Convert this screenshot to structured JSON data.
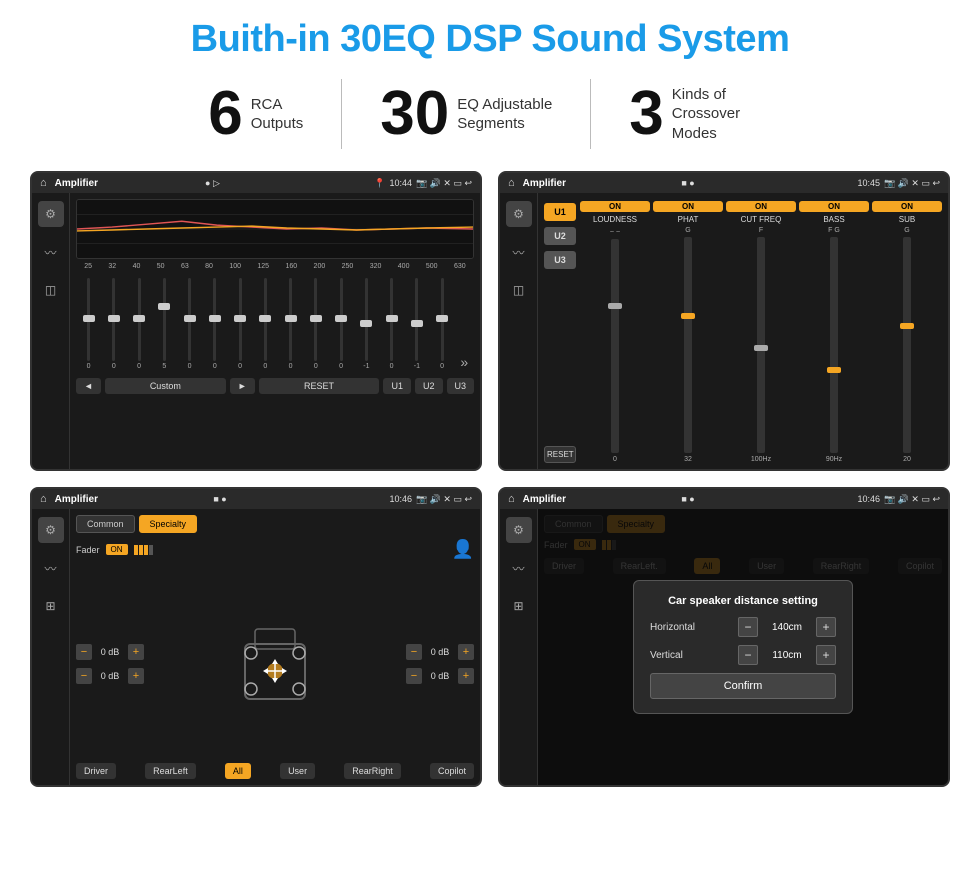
{
  "header": {
    "title": "Buith-in 30EQ DSP Sound System"
  },
  "stats": [
    {
      "number": "6",
      "label": "RCA\nOutputs"
    },
    {
      "number": "30",
      "label": "EQ Adjustable\nSegments"
    },
    {
      "number": "3",
      "label": "Kinds of\nCrossover Modes"
    }
  ],
  "screens": [
    {
      "id": "eq-screen",
      "status_bar": {
        "app": "Amplifier",
        "time": "10:44"
      },
      "eq_bands": [
        "25",
        "32",
        "40",
        "50",
        "63",
        "80",
        "100",
        "125",
        "160",
        "200",
        "250",
        "320",
        "400",
        "500",
        "630"
      ],
      "eq_values": [
        "0",
        "0",
        "0",
        "5",
        "0",
        "0",
        "0",
        "0",
        "0",
        "0",
        "0",
        "-1",
        "0",
        "-1"
      ],
      "controls": [
        "◄",
        "Custom",
        "►",
        "RESET",
        "U1",
        "U2",
        "U3"
      ]
    },
    {
      "id": "crossover-screen",
      "status_bar": {
        "app": "Amplifier",
        "time": "10:45"
      },
      "presets": [
        "U1",
        "U2",
        "U3"
      ],
      "params": [
        {
          "name": "LOUDNESS",
          "on": true
        },
        {
          "name": "PHAT",
          "on": true
        },
        {
          "name": "CUT FREQ",
          "on": true
        },
        {
          "name": "BASS",
          "on": true
        },
        {
          "name": "SUB",
          "on": true
        }
      ]
    },
    {
      "id": "speaker-screen",
      "status_bar": {
        "app": "Amplifier",
        "time": "10:46"
      },
      "tabs": [
        "Common",
        "Specialty"
      ],
      "fader": {
        "label": "Fader",
        "on": true
      },
      "vol_groups": [
        {
          "top": "0 dB",
          "bottom": "0 dB"
        },
        {
          "top": "0 dB",
          "bottom": "0 dB"
        }
      ],
      "bottom_labels": [
        "Driver",
        "RearLeft",
        "All",
        "User",
        "RearRight",
        "Copilot"
      ]
    },
    {
      "id": "speaker-dialog-screen",
      "status_bar": {
        "app": "Amplifier",
        "time": "10:46"
      },
      "tabs": [
        "Common",
        "Specialty"
      ],
      "dialog": {
        "title": "Car speaker distance setting",
        "fields": [
          {
            "label": "Horizontal",
            "value": "140cm"
          },
          {
            "label": "Vertical",
            "value": "110cm"
          }
        ],
        "confirm_label": "Confirm"
      },
      "bottom_labels": [
        "Driver",
        "RearLeft",
        "All",
        "User",
        "RearRight",
        "Copilot"
      ]
    }
  ],
  "colors": {
    "accent": "#1a9be8",
    "gold": "#f5a623",
    "dark_bg": "#1a1a1a",
    "panel_bg": "#2a2a2a"
  }
}
